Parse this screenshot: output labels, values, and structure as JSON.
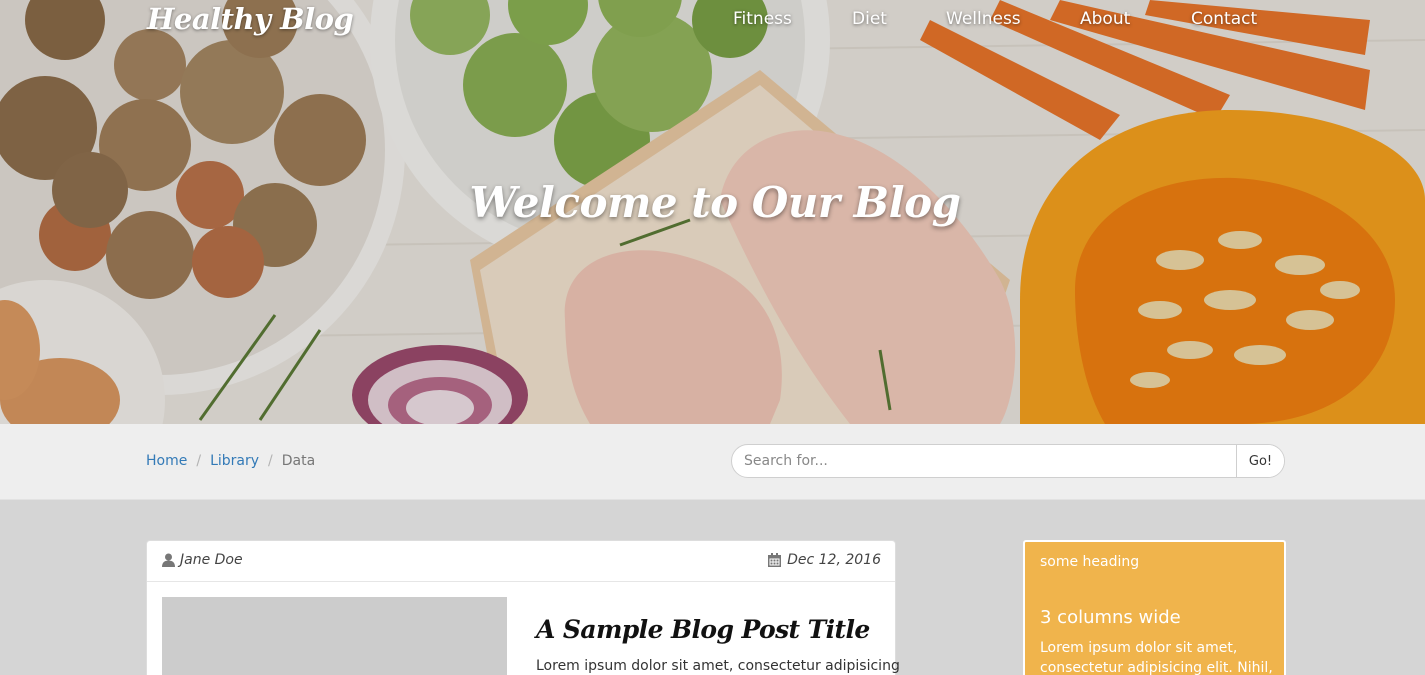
{
  "brand": "Healthy Blog",
  "nav": [
    "Fitness",
    "Diet",
    "Wellness",
    "About",
    "Contact"
  ],
  "hero": {
    "title": "Welcome to Our Blog"
  },
  "breadcrumb": {
    "items": [
      "Home",
      "Library"
    ],
    "active": "Data"
  },
  "search": {
    "placeholder": "Search for...",
    "button": "Go!"
  },
  "post": {
    "author": "Jane Doe",
    "date": "Dec 12, 2016",
    "title": "A Sample Blog Post Title",
    "excerpt": "Lorem ipsum dolor sit amet, consectetur adipisicing"
  },
  "sidebar": {
    "heading": "some heading",
    "title": "3 columns wide",
    "body": "Lorem ipsum dolor sit amet, consectetur adipisicing elit. Nihil,"
  },
  "icons": {
    "author": "user-icon",
    "date": "calendar-icon"
  },
  "colors": {
    "accent": "#f0b44c",
    "link": "#337ab7",
    "bar": "#eeeeee",
    "page": "#d5d5d5"
  }
}
